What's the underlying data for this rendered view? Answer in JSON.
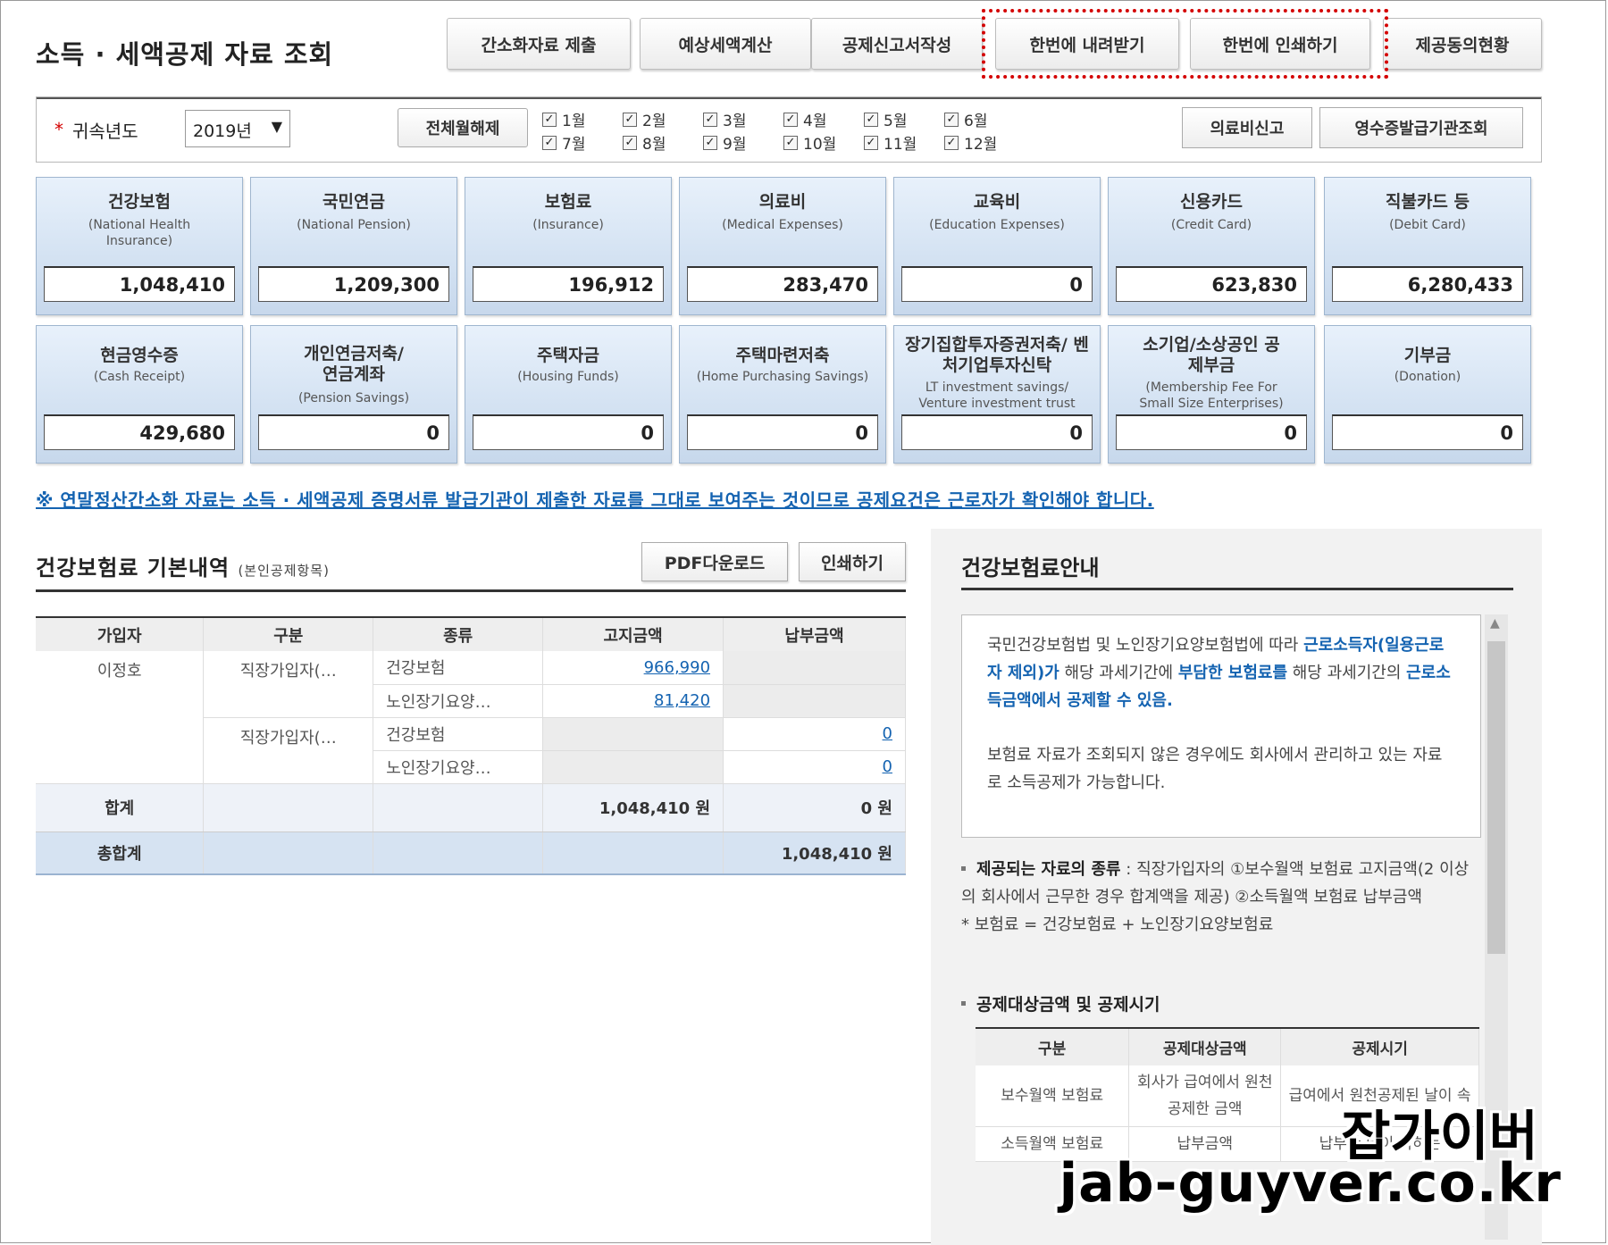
{
  "page": {
    "title": "소득 · 세액공제 자료 조회"
  },
  "top_buttons": [
    "간소화자료 제출",
    "예상세액계산",
    "공제신고서작성",
    "한번에 내려받기",
    "한번에 인쇄하기",
    "제공동의현황"
  ],
  "filter": {
    "required_mark": "*",
    "year_label": "귀속년도",
    "year_value": "2019년",
    "clear_button": "전체월해제",
    "months": [
      "1월",
      "2월",
      "3월",
      "4월",
      "5월",
      "6월",
      "7월",
      "8월",
      "9월",
      "10월",
      "11월",
      "12월"
    ],
    "side_buttons": [
      "의료비신고",
      "영수증발급기관조회"
    ]
  },
  "cards": [
    {
      "title": "건강보험",
      "sub": "(National Health Insurance)",
      "value": "1,048,410"
    },
    {
      "title": "국민연금",
      "sub": "(National Pension)",
      "value": "1,209,300"
    },
    {
      "title": "보험료",
      "sub": "(Insurance)",
      "value": "196,912"
    },
    {
      "title": "의료비",
      "sub": "(Medical Expenses)",
      "value": "283,470"
    },
    {
      "title": "교육비",
      "sub": "(Education Expenses)",
      "value": "0"
    },
    {
      "title": "신용카드",
      "sub": "(Credit Card)",
      "value": "623,830"
    },
    {
      "title": "직불카드 등",
      "sub": "(Debit Card)",
      "value": "6,280,433"
    },
    {
      "title": "현금영수증",
      "sub": "(Cash Receipt)",
      "value": "429,680"
    },
    {
      "title": "개인연금저축/ 연금계좌",
      "sub": "(Pension Savings)",
      "value": "0"
    },
    {
      "title": "주택자금",
      "sub": "(Housing Funds)",
      "value": "0"
    },
    {
      "title": "주택마련저축",
      "sub": "(Home Purchasing Savings)",
      "value": "0"
    },
    {
      "title": "장기집합투자증권저축/ 벤처기업투자신탁",
      "sub": "LT investment savings/ Venture investment trust",
      "value": "0"
    },
    {
      "title": "소기업/소상공인 공제부금",
      "sub": "(Membership Fee For Small Size Enterprises)",
      "value": "0"
    },
    {
      "title": "기부금",
      "sub": "(Donation)",
      "value": "0"
    }
  ],
  "notice": "※ 연말정산간소화 자료는 소득 · 세액공제 증명서류 발급기관이 제출한 자료를 그대로 보여주는 것이므로 공제요건은 근로자가 확인해야 합니다.",
  "hi_section": {
    "title": "건강보험료 기본내역",
    "title_note": "(본인공제항목)",
    "pdf_button": "PDF다운로드",
    "print_button": "인쇄하기",
    "headers": [
      "가입자",
      "구분",
      "종류",
      "고지금액",
      "납부금액"
    ],
    "subscriber": "이정호",
    "type_a": "직장가입자(…",
    "type_b": "직장가입자(…",
    "kind_health": "건강보험",
    "kind_ltc": "노인장기요양…",
    "kind_health_2": "건강보험",
    "kind_ltc_2": "노인장기요양…",
    "billed_health": "966,990",
    "billed_ltc": "81,420",
    "paid_health": "0",
    "paid_ltc": "0",
    "sum_label": "합계",
    "sum_billed": "1,048,410 원",
    "sum_paid": "0 원",
    "total_label": "총합계",
    "total_value": "1,048,410 원"
  },
  "guide": {
    "title": "건강보험료안내",
    "p1_a": "국민건강보험법 및 노인장기요양보험법에 따라 ",
    "p1_b": "근로소득자(일용근로자 제외)가",
    "p1_c": " 해당 과세기간에 ",
    "p1_d": "부담한 보험료를",
    "p1_e": " 해당 과세기간의 ",
    "p1_f": "근로소득금액에서 공제할 수 있음.",
    "p2": "보험료 자료가 조회되지 않은 경우에도 회사에서 관리하고 있는 자료로 소득공제가 가능합니다.",
    "b1_title": "제공되는 자료의 종류",
    "b1_text": " : 직장가입자의 ①보수월액 보험료 고지금액(2 이상의 회사에서 근무한 경우 합계액을 제공) ②소득월액 보험료 납부금액",
    "b1_note": "* 보험료 = 건강보험료 + 노인장기요양보험료",
    "b2_title": "공제대상금액 및 공제시기",
    "ded_headers": [
      "구분",
      "공제대상금액",
      "공제시기"
    ],
    "ded_rows": [
      [
        "보수월액 보험료",
        "회사가 급여에서 원천공제한 금액",
        "급여에서 원천공제된 날이 속"
      ],
      [
        "소득월액 보험료",
        "납부금액",
        "납부한 날이 속하는"
      ]
    ]
  },
  "watermark": {
    "line1": "잡가이버",
    "line2": "jab-guyver.co.kr"
  }
}
